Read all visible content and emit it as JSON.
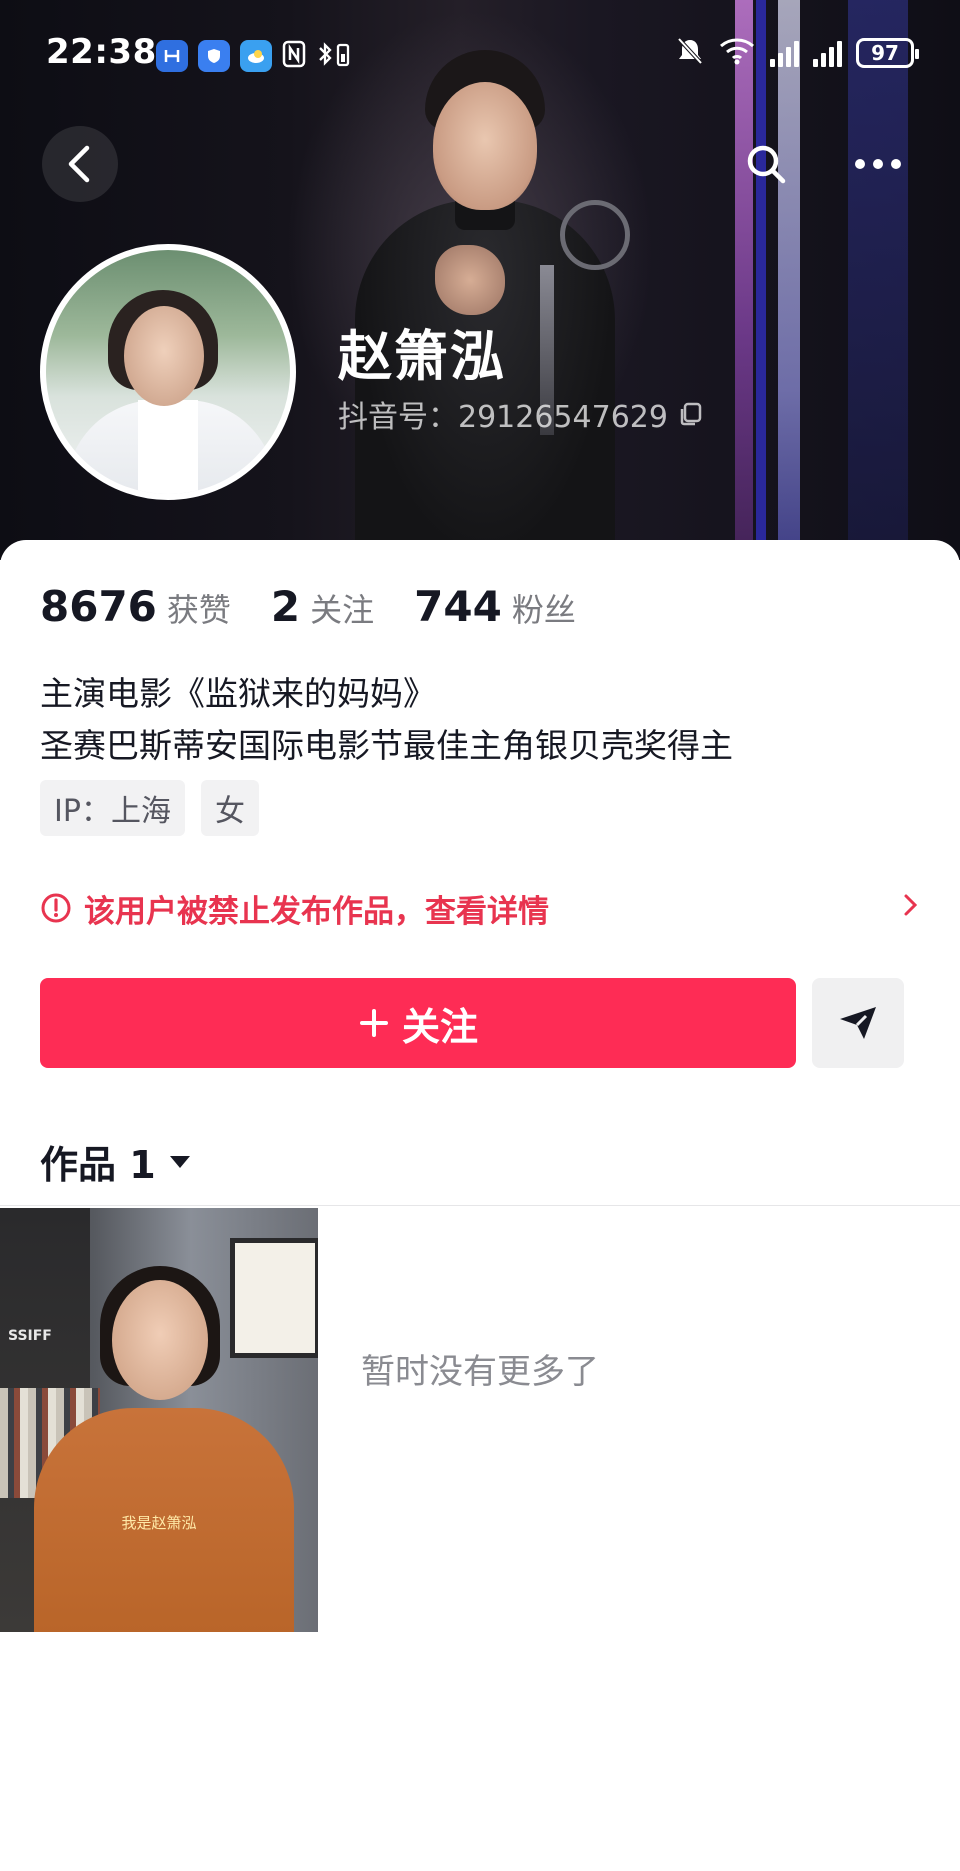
{
  "status_bar": {
    "time": "22:38",
    "battery": "97"
  },
  "profile": {
    "name": "赵箫泓",
    "douyin_id": "抖音号：29126547629"
  },
  "stats": [
    {
      "num": "8676",
      "label": "获赞"
    },
    {
      "num": "2",
      "label": "关注"
    },
    {
      "num": "744",
      "label": "粉丝"
    }
  ],
  "bio": {
    "line1": "主演电影《监狱来的妈妈》",
    "line2": "圣赛巴斯蒂安国际电影节最佳主角银贝壳奖得主"
  },
  "tags": {
    "ip": "IP：上海",
    "gender": "女"
  },
  "notice": {
    "text": "该用户被禁止发布作品，查看详情"
  },
  "actions": {
    "follow": "关注"
  },
  "works": {
    "label": "作品 1",
    "video_caption": "我是赵箫泓",
    "thumb_sign": "SSIFF"
  },
  "footer": {
    "end_text": "暂时没有更多了"
  },
  "colors": {
    "accent": "#fe2c55",
    "notice": "#e8344f"
  }
}
